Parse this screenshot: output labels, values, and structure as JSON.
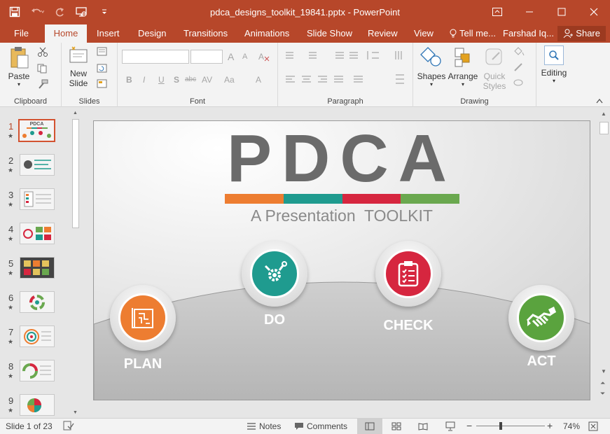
{
  "titlebar": {
    "document_title": "pdca_designs_toolkit_19841.pptx - PowerPoint",
    "brand_color": "#b7472a"
  },
  "tabs": [
    {
      "label": "File"
    },
    {
      "label": "Home"
    },
    {
      "label": "Insert"
    },
    {
      "label": "Design"
    },
    {
      "label": "Transitions"
    },
    {
      "label": "Animations"
    },
    {
      "label": "Slide Show"
    },
    {
      "label": "Review"
    },
    {
      "label": "View"
    },
    {
      "label": "Tell me..."
    },
    {
      "label": "Farshad Iq..."
    }
  ],
  "share_label": "Share",
  "ribbon": {
    "clipboard": {
      "paste": "Paste",
      "label": "Clipboard"
    },
    "slides": {
      "new_slide_1": "New",
      "new_slide_2": "Slide",
      "label": "Slides"
    },
    "font": {
      "label": "Font",
      "bold": "B",
      "italic": "I",
      "underline": "U",
      "strike": "S",
      "shadow": "abc",
      "spacing": "AV",
      "case": "Aa",
      "color": "A",
      "grow": "A",
      "shrink": "A"
    },
    "paragraph": {
      "label": "Paragraph"
    },
    "drawing": {
      "shapes": "Shapes",
      "arrange": "Arrange",
      "quick_1": "Quick",
      "quick_2": "Styles",
      "label": "Drawing"
    },
    "editing": {
      "label": "Editing"
    }
  },
  "thumbnails": [
    {
      "num": "1",
      "star": "★"
    },
    {
      "num": "2",
      "star": "★"
    },
    {
      "num": "3",
      "star": "★"
    },
    {
      "num": "4",
      "star": "★"
    },
    {
      "num": "5",
      "star": "★"
    },
    {
      "num": "6",
      "star": "★"
    },
    {
      "num": "7",
      "star": "★"
    },
    {
      "num": "8",
      "star": "★"
    },
    {
      "num": "9",
      "star": "★"
    }
  ],
  "thumb1_text": "PDCA",
  "slide": {
    "title": "PDCA",
    "subtitle": "A Presentation  TOOLKIT",
    "bar_colors": [
      "#ed7d31",
      "#1f9b8f",
      "#d6263f",
      "#6aa84f"
    ],
    "steps": [
      {
        "label": "PLAN",
        "color": "#ed7d31",
        "icon": "blueprint-icon"
      },
      {
        "label": "DO",
        "color": "#1f9b8f",
        "icon": "tools-icon"
      },
      {
        "label": "CHECK",
        "color": "#d6263f",
        "icon": "clipboard-icon"
      },
      {
        "label": "ACT",
        "color": "#5aa33e",
        "icon": "handshake-icon"
      }
    ]
  },
  "status": {
    "slide_info": "Slide 1 of 23",
    "notes": "Notes",
    "comments": "Comments",
    "zoom": "74%",
    "zoom_level": 0.74
  }
}
